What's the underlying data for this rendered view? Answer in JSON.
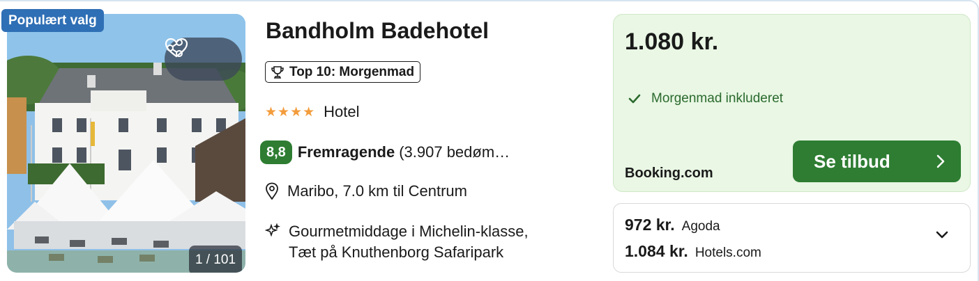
{
  "card": {
    "image": {
      "badge": "Populært valg",
      "counter": "1 / 101"
    },
    "hotel": {
      "name": "Bandholm Badehotel",
      "award": "Top 10: Morgenmad",
      "stars": 4,
      "star_text": "★★★★",
      "type": "Hotel",
      "score": "8,8",
      "rating_word": "Fremragende",
      "rating_count": "(3.907 bedøm…",
      "location": "Maribo, 7.0 km til Centrum",
      "feature_line1": "Gourmetmiddage i Michelin-klasse,",
      "feature_line2": "Tæt på Knuthenborg Safaripark"
    },
    "offer": {
      "price": "1.080 kr.",
      "perk": "Morgenmad inkluderet",
      "provider": "Booking.com",
      "cta": "Se tilbud"
    },
    "alternatives": [
      {
        "price": "972 kr.",
        "provider": "Agoda"
      },
      {
        "price": "1.084 kr.",
        "provider": "Hotels.com"
      }
    ]
  },
  "colors": {
    "badge_blue": "#2f6fb5",
    "green": "#2e7d32",
    "offer_bg": "#e9f7e4",
    "star": "#f39c3c"
  },
  "icons": [
    "share-icon",
    "heart-icon",
    "trophy-icon",
    "map-pin-icon",
    "sparkle-icon",
    "checkmark-icon",
    "chevron-right-icon",
    "chevron-down-icon"
  ]
}
